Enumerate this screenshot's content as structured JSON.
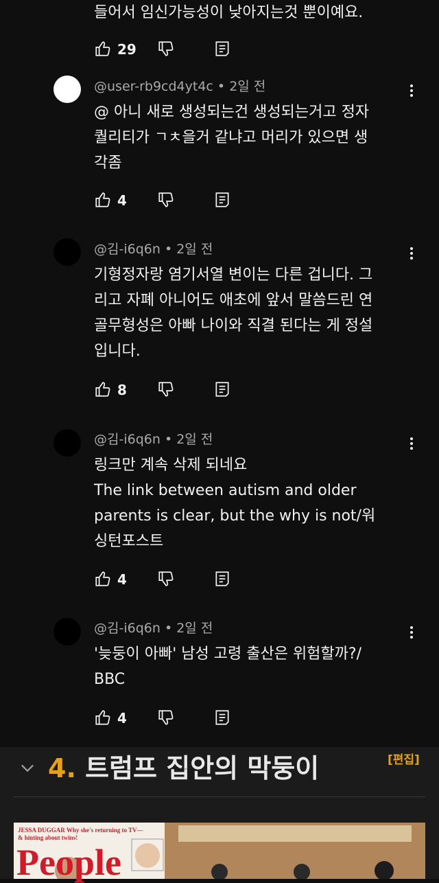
{
  "top_comment": {
    "text_tail": "들어서 임신가능성이 낮아지는것 뿐이예요.",
    "likes": "29"
  },
  "comments": [
    {
      "author": "@user-rb9cd4yt4c",
      "time": "2일 전",
      "text": "@ 아니 새로 생성되는건 생성되는거고 정자\n퀄리티가 ㄱㅊ을거 같냐고 머리가 있으면 생\n각좀",
      "likes": "4",
      "avatar_color": "#ffffff"
    },
    {
      "author": "@김-i6q6n",
      "time": "2일 전",
      "text": "기형정자랑 염기서열 변이는 다른 겁니다. 그\n리고 자폐 아니어도 애초에 앞서 말씀드린 연\n골무형성은 아빠 나이와 직결 된다는 게 정설\n입니다.",
      "likes": "8",
      "avatar_color": "#000000"
    },
    {
      "author": "@김-i6q6n",
      "time": "2일 전",
      "text": "링크만 계속 삭제 되네요\nThe link between autism and older\nparents is clear, but the why is not/워\n싱턴포스트",
      "likes": "4",
      "avatar_color": "#000000"
    },
    {
      "author": "@김-i6q6n",
      "time": "2일 전",
      "text": "'늦둥이 아빠' 남성 고령 출산은 위험할까?/\nBBC",
      "likes": "4",
      "avatar_color": "#000000"
    }
  ],
  "meta_sep": "•",
  "section": {
    "number": "4.",
    "title": "트럼프 집안의 막둥이",
    "edit_label": "[편집]"
  },
  "thumbnail": {
    "cover_line1": "JESSA DUGGAR Why she's returning to TV—",
    "cover_line2": "& hinting about twins!",
    "logo": "People"
  },
  "colors": {
    "background": "#0f0f0f",
    "accent": "#e3a21a",
    "meta": "#aaaaaa"
  },
  "icons": [
    "like-icon",
    "dislike-icon",
    "reply-icon",
    "more-icon",
    "chevron-down-icon"
  ]
}
